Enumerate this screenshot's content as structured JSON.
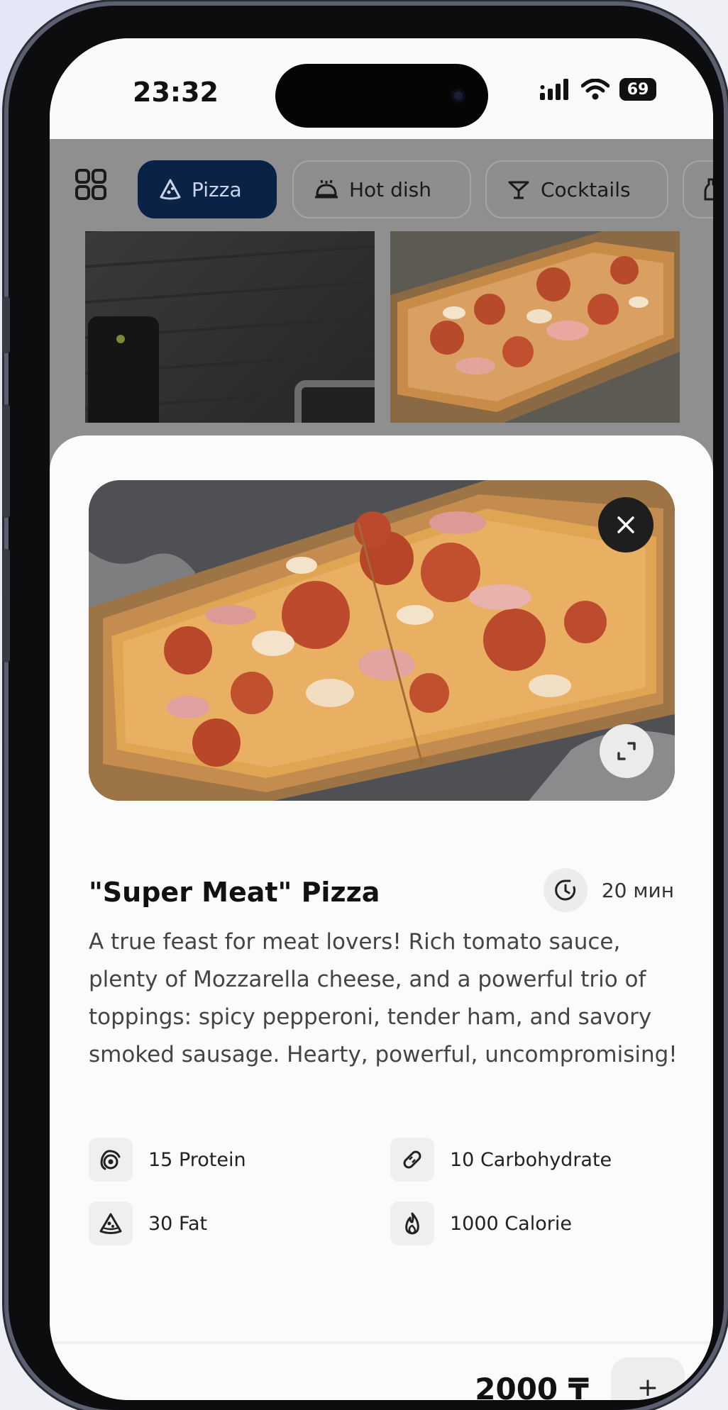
{
  "status_bar": {
    "time": "23:32",
    "battery": "69"
  },
  "categories": {
    "tabs": [
      {
        "label": "Pizza",
        "icon": "pizza-slice-icon",
        "active": true
      },
      {
        "label": "Hot dish",
        "icon": "cloche-icon",
        "active": false
      },
      {
        "label": "Cocktails",
        "icon": "cocktail-icon",
        "active": false
      }
    ]
  },
  "product": {
    "title": "\"Super Meat\" Pizza",
    "cook_time": "20 мин",
    "description": "A true feast for meat lovers! Rich tomato sauce, plenty of Mozzarella cheese, and a powerful trio of toppings: spicy pepperoni, tender ham, and savory smoked sausage. Hearty, powerful, uncompromising!",
    "nutrition": [
      {
        "label": "15 Protein",
        "icon": "egg-icon"
      },
      {
        "label": "10 Carbohydrate",
        "icon": "pill-icon"
      },
      {
        "label": "30 Fat",
        "icon": "pizza-slice-icon"
      },
      {
        "label": "1000 Calorie",
        "icon": "flame-icon"
      }
    ],
    "price": "2000 ₸",
    "add_label": "+"
  },
  "colors": {
    "accent": "#0a2246",
    "sheet": "#fbfbfb",
    "dim_overlay": "#8f8f8f"
  }
}
